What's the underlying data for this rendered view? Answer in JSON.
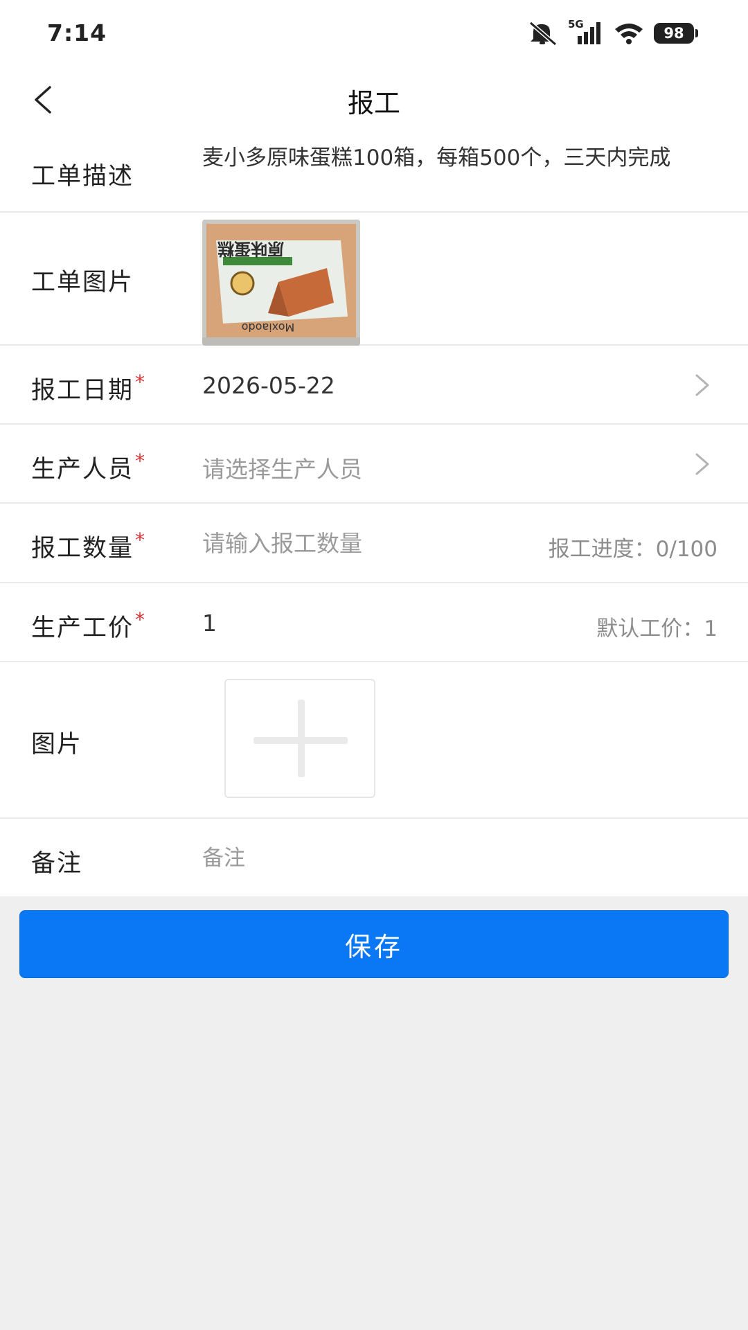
{
  "status_bar": {
    "time": "7:14",
    "network": "5G",
    "battery": "98",
    "icons": [
      "mute-icon",
      "signal-icon",
      "wifi-icon",
      "battery-icon"
    ]
  },
  "nav": {
    "title": "报工",
    "back_icon": "chevron-left-icon"
  },
  "form": {
    "description": {
      "label": "工单描述",
      "value": "麦小多原味蛋糕100箱，每箱500个，三天内完成"
    },
    "image": {
      "label": "工单图片",
      "thumb_text": "Moxiaodo",
      "thumb_title": "原味蛋糕"
    },
    "date": {
      "label": "报工日期",
      "required_mark": "*",
      "value": "2026-05-22"
    },
    "staff": {
      "label": "生产人员",
      "required_mark": "*",
      "placeholder": "请选择生产人员"
    },
    "quantity": {
      "label": "报工数量",
      "required_mark": "*",
      "placeholder": "请输入报工数量",
      "progress_text": "报工进度：0/100"
    },
    "price": {
      "label": "生产工价",
      "required_mark": "*",
      "value": "1",
      "default_text": "默认工价：1"
    },
    "photos": {
      "label": "图片",
      "add_icon": "plus-icon"
    },
    "remark": {
      "label": "备注",
      "placeholder": "备注"
    }
  },
  "save_button": {
    "label": "保存",
    "color": "#0a78f5"
  }
}
